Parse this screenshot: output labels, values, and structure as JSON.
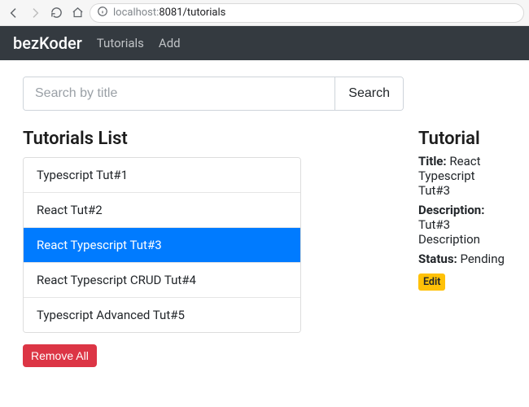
{
  "browser": {
    "url_host": "localhost:",
    "url_port_path": "8081/tutorials"
  },
  "navbar": {
    "brand": "bezKoder",
    "links": [
      {
        "label": "Tutorials"
      },
      {
        "label": "Add"
      }
    ]
  },
  "search": {
    "placeholder": "Search by title",
    "value": "",
    "button": "Search"
  },
  "list": {
    "heading": "Tutorials List",
    "items": [
      {
        "title": "Typescript Tut#1",
        "active": false
      },
      {
        "title": "React Tut#2",
        "active": false
      },
      {
        "title": "React Typescript Tut#3",
        "active": true
      },
      {
        "title": "React Typescript CRUD Tut#4",
        "active": false
      },
      {
        "title": "Typescript Advanced Tut#5",
        "active": false
      }
    ],
    "removeAll": "Remove All"
  },
  "detail": {
    "heading": "Tutorial",
    "titleLabel": "Title:",
    "titleValue": "React Typescript Tut#3",
    "descLabel": "Description:",
    "descValue": "Tut#3 Description",
    "statusLabel": "Status:",
    "statusValue": "Pending",
    "editLabel": "Edit"
  }
}
